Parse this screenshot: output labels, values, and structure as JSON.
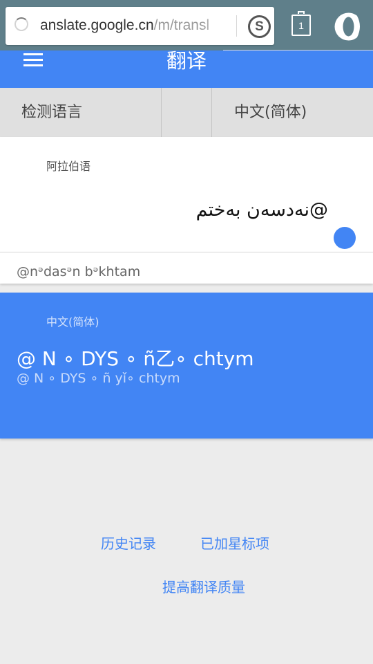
{
  "browser": {
    "url_visible": "anslate.google.cn",
    "url_path": "/m/transl",
    "tab_count": "1",
    "icons": {
      "loading": "loading-spinner-icon",
      "search_engine": "sogou-s-icon",
      "tabs": "tab-switcher-icon",
      "menu": "opera-logo-icon"
    }
  },
  "app": {
    "title": "翻译",
    "menu_icon": "hamburger-menu-icon",
    "accent_color": "#4285f4"
  },
  "language_bar": {
    "source_label": "检测语言",
    "target_label": "中文(简体)"
  },
  "input": {
    "detected_language": "阿拉伯语",
    "source_text": "@نەدسەن بەختم",
    "transliteration": "@nᵊdasᵊn bᵊkhtam",
    "mic_icon": "microphone-icon"
  },
  "result": {
    "language": "中文(简体)",
    "translation": "@ N ∘ DYS ∘ ñ乙∘ chtym",
    "transliteration": "@ N ∘ DYS ∘ ñ yǐ∘ chtym"
  },
  "links": {
    "history": "历史记录",
    "starred": "已加星标项",
    "improve": "提高翻译质量"
  }
}
